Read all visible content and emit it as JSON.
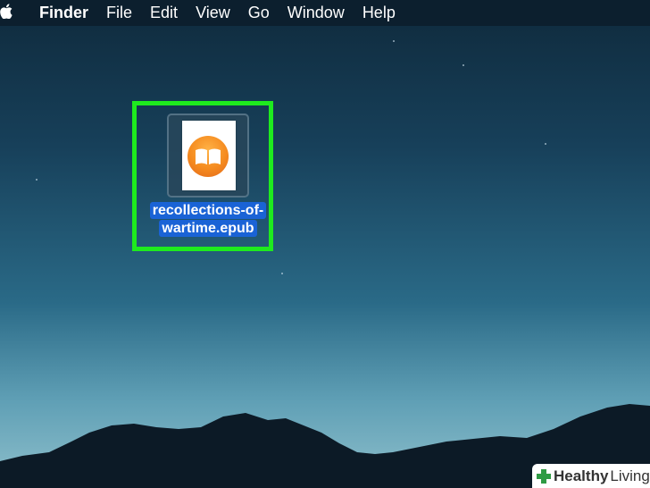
{
  "menubar": {
    "apple_icon": "apple-logo-icon",
    "items": [
      "Finder",
      "File",
      "Edit",
      "View",
      "Go",
      "Window",
      "Help"
    ]
  },
  "desktop": {
    "file": {
      "name_line1": "recollections-of-",
      "name_line2": "wartime.epub",
      "icon": "ibooks-epub-icon"
    },
    "highlight_color": "#1eeb1e",
    "selection_color": "#1a63d6"
  },
  "watermark": {
    "text_bold": "Healthy",
    "text_regular": "Living",
    "icon": "green-cross-icon"
  }
}
